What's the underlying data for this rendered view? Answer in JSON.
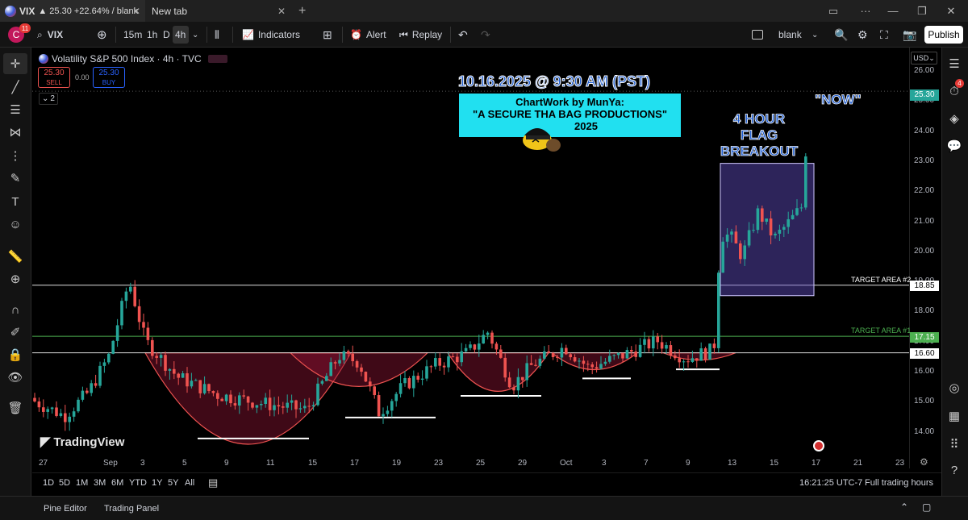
{
  "browser": {
    "tab1_title": "VIX",
    "tab1_badge": "▲ 25.30 +22.64% / blank",
    "tab2_title": "New tab",
    "new_tab": "+",
    "min": "—",
    "max": "❐",
    "close": "✕"
  },
  "toolbar": {
    "avatar": "C",
    "avatar_badge": "11",
    "symbol": "VIX",
    "add": "⊕",
    "intervals": [
      "15m",
      "1h",
      "D",
      "4h"
    ],
    "indicators": "Indicators",
    "alert": "Alert",
    "replay": "Replay",
    "layout_name": "blank",
    "publish": "Publish"
  },
  "legend": {
    "title": "Volatility S&P 500 Index · 4h · TVC",
    "sell_price": "25.30",
    "sell_label": "SELL",
    "spread": "0.00",
    "buy_price": "25.30",
    "buy_label": "BUY",
    "collapse": "2"
  },
  "annotations": {
    "date": "10.16.2025 @ 9:30 AM (PST)",
    "credit_line1": "ChartWork by MunYa:",
    "credit_line2": "\"A SECURE THA BAG PRODUCTIONS\"",
    "credit_line3": "2025",
    "flag_line1": "4 HOUR",
    "flag_line2": "FLAG",
    "flag_line3": "BREAKOUT",
    "now": "\"NOW\"",
    "target2": "TARGET AREA #2",
    "target1": "TARGET AREA #1"
  },
  "price_axis": {
    "currency": "USD",
    "ticks": [
      "26.00",
      "25.00",
      "24.00",
      "23.00",
      "22.00",
      "21.00",
      "20.00",
      "19.00",
      "18.00",
      "17.00",
      "16.00",
      "15.00",
      "14.00"
    ],
    "label_1885": "18.85",
    "label_1715": "17.15",
    "label_1660": "16.60",
    "label_last": "25.30"
  },
  "time_axis": [
    "27",
    "Sep",
    "3",
    "5",
    "9",
    "11",
    "15",
    "17",
    "19",
    "23",
    "25",
    "29",
    "Oct",
    "3",
    "7",
    "9",
    "13",
    "15",
    "17",
    "21",
    "23"
  ],
  "ranges": [
    "1D",
    "5D",
    "1M",
    "3M",
    "6M",
    "YTD",
    "1Y",
    "5Y",
    "All"
  ],
  "clock": "16:21:25 UTC-7",
  "session": "Full trading hours",
  "footer": {
    "pine": "Pine Editor",
    "panel": "Trading Panel"
  },
  "watermark": "TradingView",
  "colors": {
    "up": "#26a69a",
    "down": "#ef5350",
    "accent": "#2962ff",
    "target1": "#4caf50"
  }
}
